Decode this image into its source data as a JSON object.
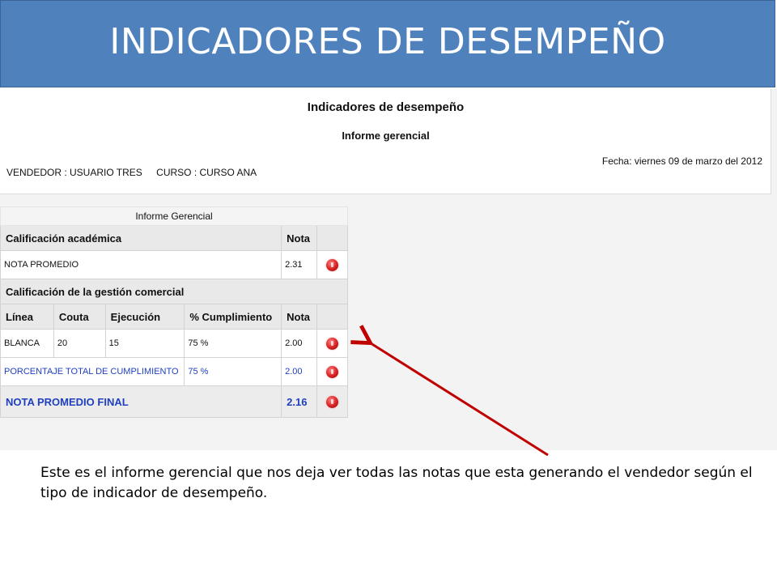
{
  "slide": {
    "title": "INDICADORES DE DESEMPEÑO",
    "caption": "Este es el informe gerencial que nos deja ver todas las notas que esta generando el vendedor según el tipo de indicador de desempeño."
  },
  "report": {
    "title": "Indicadores de desempeño",
    "subtitle": "Informe gerencial",
    "date": "Fecha: viernes 09 de marzo del 2012",
    "vendedor": "VENDEDOR : USUARIO TRES",
    "curso": "CURSO : CURSO ANA"
  },
  "table": {
    "caption": "Informe Gerencial",
    "academic_header": "Calificación académica",
    "nota_header": "Nota",
    "academic_row": {
      "label": "NOTA PROMEDIO",
      "nota": "2.31"
    },
    "commercial_header": "Calificación de la gestión comercial",
    "columns": [
      "Línea",
      "Couta",
      "Ejecución",
      "% Cumplimiento",
      "Nota"
    ],
    "commercial_row": {
      "linea": "BLANCA",
      "couta": "20",
      "ejecucion": "15",
      "cumplimiento": "75 %",
      "nota": "2.00"
    },
    "total_row": {
      "label": "PORCENTAJE TOTAL DE CUMPLIMIENTO",
      "cumplimiento": "75 %",
      "nota": "2.00"
    },
    "final_row": {
      "label": "NOTA PROMEDIO FINAL",
      "nota": "2.16"
    }
  },
  "colors": {
    "title_bar": "#4f81bd",
    "arrow": "#c00000",
    "blue_text": "#1f3fbf"
  },
  "icons": {
    "status": "red-status-icon"
  }
}
